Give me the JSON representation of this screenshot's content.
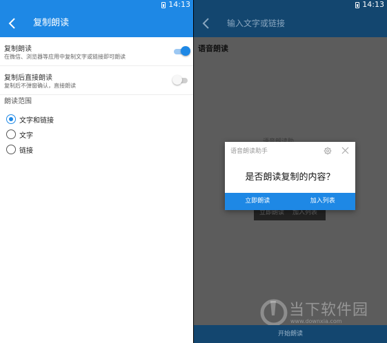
{
  "status_bar": {
    "time": "14:13"
  },
  "left": {
    "title": "复制朗读",
    "settings": [
      {
        "title": "复制朗读",
        "desc": "在微信、浏览器等应用中复制文字或链接即可朗读",
        "enabled": true
      },
      {
        "title": "复制后直接朗读",
        "desc": "复制后不弹窗确认，直接朗读",
        "enabled": false
      }
    ],
    "section_label": "朗读范围",
    "options": [
      {
        "label": "文字和链接",
        "checked": true
      },
      {
        "label": "文字",
        "checked": false
      },
      {
        "label": "链接",
        "checked": false
      }
    ]
  },
  "right": {
    "placeholder": "输入文字或链接",
    "content": "语音朗读",
    "dim_label": "语音朗读助",
    "dim_buttons": [
      "立即朗读",
      "加入列表"
    ],
    "dialog": {
      "header": "语音朗读助手",
      "question": "是否朗读复制的内容？",
      "read_now": "立即朗读",
      "add_to_list": "加入列表"
    },
    "start_button": "开始朗读",
    "watermark": {
      "name": "当下软件园",
      "url": "www.downxia.com"
    }
  },
  "colors": {
    "primary": "#1e88e5",
    "dark_primary": "#13466f"
  }
}
